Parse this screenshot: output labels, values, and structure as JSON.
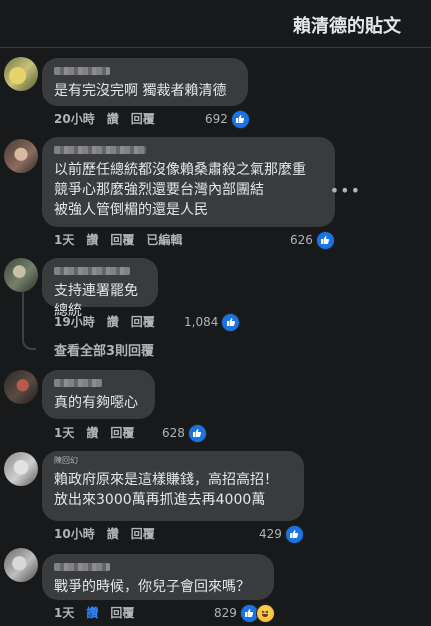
{
  "header": {
    "title": "賴清德的貼文"
  },
  "labels": {
    "like": "讚",
    "reply": "回覆",
    "edited": "已編輯"
  },
  "comments": [
    {
      "text": "是有完沒完啊 獨裁者賴清德",
      "time": "20小時",
      "reactions": "692",
      "edited": false
    },
    {
      "text": "以前歷任總統都沒像賴桑肅殺之氣那麼重\n競爭心那麼強烈還要台灣內部團結\n被強人管倒楣的還是人民",
      "time": "1天",
      "reactions": "626",
      "edited": true
    },
    {
      "text": "支持連署罷免總統",
      "time": "19小時",
      "reactions": "1,084",
      "edited": false
    },
    {
      "text": "真的有夠噁心",
      "time": "1天",
      "reactions": "628",
      "edited": false
    },
    {
      "author_partial": "陳回幻",
      "text": "賴政府原來是這樣賺錢，高招高招！\n放出來3000萬再抓進去再4000萬",
      "time": "10小時",
      "reactions": "429",
      "edited": false
    },
    {
      "text": "戰爭的時候，你兒子會回來嗎？",
      "time": "1天",
      "reactions": "829",
      "edited": false,
      "liked": true
    }
  ],
  "view_replies": "查看全部3則回覆",
  "icons": {
    "like": "thumbs-up-icon",
    "haha": "haha-emoji-icon",
    "more": "more-horizontal-icon"
  },
  "colors": {
    "background": "#18191a",
    "bubble": "#3a3b3c",
    "accent": "#1b74e4"
  }
}
